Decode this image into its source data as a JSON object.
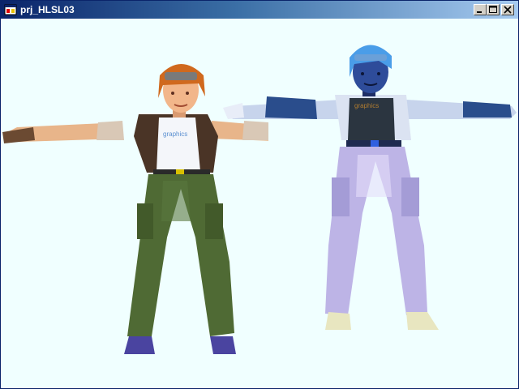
{
  "window": {
    "title": "prj_HLSL03",
    "icon": "app-window-icon",
    "controls": [
      "minimize-icon",
      "maximize-icon",
      "close-icon"
    ],
    "client_background": "#f0ffff"
  },
  "scene": {
    "models": [
      {
        "name": "textured-character",
        "shading": "original-texture"
      },
      {
        "name": "shaded-character",
        "shading": "blue-tinted-hlsl"
      }
    ]
  }
}
